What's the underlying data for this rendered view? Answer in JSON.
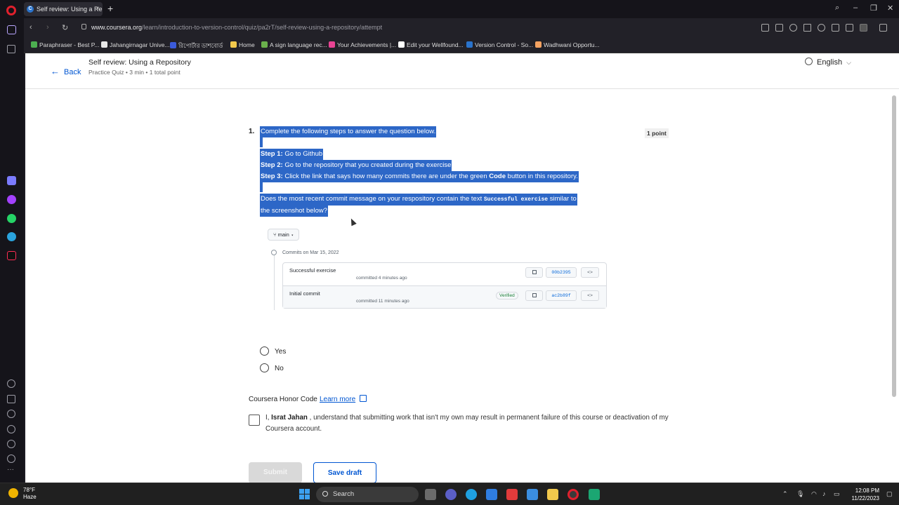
{
  "browser": {
    "tab_title": "Self review: Using a Repo",
    "tab_close": "×",
    "new_tab": "+",
    "url_domain": "www.coursera.org",
    "url_path": "/learn/introduction-to-version-control/quiz/pa2rT/self-review-using-a-repository/attempt",
    "bookmarks": [
      {
        "label": "Paraphraser - Best P...",
        "color": "#4caf50"
      },
      {
        "label": "Jahangirnagar Unive...",
        "color": "#e8e8e8"
      },
      {
        "label": "রিপোর্টার ডাশবোর্ড",
        "color": "#3b5bdb"
      },
      {
        "label": "Home",
        "color": "#f2c94c"
      },
      {
        "label": "A sign language rec...",
        "color": "#6ab04c"
      },
      {
        "label": "Your Achievements |...",
        "color": "#e84393"
      },
      {
        "label": "Edit your Wellfound...",
        "color": "#ffffff"
      },
      {
        "label": "Version Control - So...",
        "color": "#2a73cc"
      },
      {
        "label": "Wadhwani Opportu...",
        "color": "#f4a261"
      }
    ]
  },
  "header": {
    "back_label": "Back",
    "title": "Self review: Using a Repository",
    "meta": "Practice Quiz • 3 min • 1 total point",
    "language": "English"
  },
  "question": {
    "number": "1.",
    "points": "1 point",
    "intro": "Complete the following steps to answer the question below.",
    "steps": [
      {
        "label": "Step 1:",
        "text": " Go to Github"
      },
      {
        "label": "Step 2:",
        "text": " Go to the repository that you created during the exercise"
      },
      {
        "label": "Step 3:",
        "text": " Click the link that says how many commits there are under the green ",
        "bold": "Code",
        "tail": " button in this repository."
      }
    ],
    "prompt_before": "Does the most recent commit message on your respository contain the text ",
    "prompt_code": "Successful exercise",
    "prompt_after": " similar to",
    "prompt_line2": "the screenshot below?"
  },
  "github": {
    "branch": "main",
    "commits_date": "Commits on Mar 15, 2022",
    "commits": [
      {
        "message": "Successful exercise",
        "when": "committed 4 minutes ago",
        "verified": "",
        "sha": "00b2395",
        "code": "<>"
      },
      {
        "message": "Initial commit",
        "when": "committed 11 minutes ago",
        "verified": "Verified",
        "sha": "ac2b89f",
        "code": "<>"
      }
    ]
  },
  "options": [
    {
      "label": "Yes"
    },
    {
      "label": "No"
    }
  ],
  "honor": {
    "title": "Coursera Honor Code",
    "learn_more": "Learn more",
    "text_before": "I, ",
    "name": "Israt Jahan",
    "text_after": " , understand that submitting work that isn't my own may result in permanent failure of this course or deactivation of my Coursera account."
  },
  "actions": {
    "submit": "Submit",
    "save_draft": "Save draft"
  },
  "taskbar": {
    "temp": "78°F",
    "weather": "Haze",
    "search": "Search",
    "time": "12:08 PM",
    "date": "11/22/2023"
  }
}
